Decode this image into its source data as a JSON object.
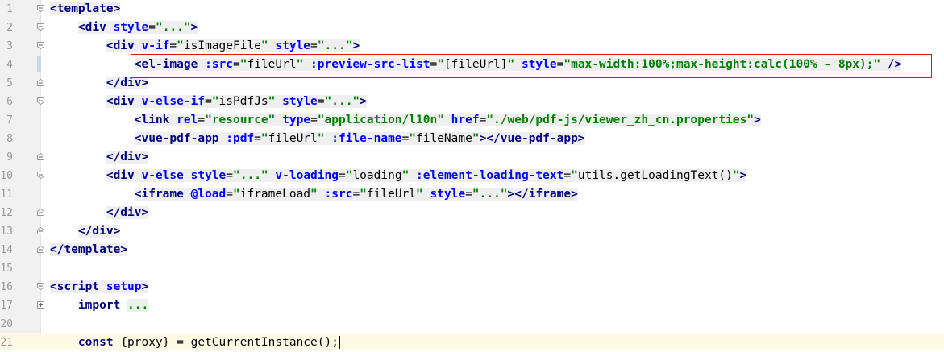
{
  "editor": {
    "line_numbers": [
      "1",
      "2",
      "3",
      "4",
      "5",
      "6",
      "7",
      "8",
      "9",
      "10",
      "11",
      "12",
      "13",
      "14",
      "15",
      "16",
      "17",
      "20",
      "21"
    ],
    "lines": [
      {
        "n": "1",
        "tokens": [
          [
            "tag",
            "<template>"
          ]
        ]
      },
      {
        "n": "2",
        "indent": "    ",
        "tokens": [
          [
            "tag",
            "<div "
          ],
          [
            "attr",
            "style"
          ],
          [
            "txt",
            "="
          ],
          [
            "str",
            "\"...\""
          ],
          [
            "tag",
            ">"
          ]
        ]
      },
      {
        "n": "3",
        "indent": "        ",
        "tokens": [
          [
            "tag",
            "<div "
          ],
          [
            "attr",
            "v-if"
          ],
          [
            "txt",
            "="
          ],
          [
            "str",
            "\""
          ],
          [
            "txt",
            "isImageFile"
          ],
          [
            "str",
            "\""
          ],
          [
            "tag",
            " "
          ],
          [
            "attr",
            "style"
          ],
          [
            "txt",
            "="
          ],
          [
            "str",
            "\"...\""
          ],
          [
            "tag",
            ">"
          ]
        ]
      },
      {
        "n": "4",
        "indent": "            ",
        "tokens": [
          [
            "tag",
            "<el-image "
          ],
          [
            "attr",
            ":src"
          ],
          [
            "txt",
            "="
          ],
          [
            "str",
            "\""
          ],
          [
            "txt",
            "fileUrl"
          ],
          [
            "str",
            "\""
          ],
          [
            "tag",
            " "
          ],
          [
            "attr",
            ":preview-src-list"
          ],
          [
            "txt",
            "="
          ],
          [
            "str",
            "\""
          ],
          [
            "txt",
            "[fileUrl]"
          ],
          [
            "str",
            "\""
          ],
          [
            "tag",
            " "
          ],
          [
            "attr",
            "style"
          ],
          [
            "txt",
            "="
          ],
          [
            "str",
            "\"max-width:100%;max-height:calc(100% - 8px);\""
          ],
          [
            "tag",
            " />"
          ]
        ]
      },
      {
        "n": "5",
        "indent": "        ",
        "tokens": [
          [
            "tag",
            "</div>"
          ]
        ]
      },
      {
        "n": "6",
        "indent": "        ",
        "tokens": [
          [
            "tag",
            "<div "
          ],
          [
            "attr",
            "v-else-if"
          ],
          [
            "txt",
            "="
          ],
          [
            "str",
            "\""
          ],
          [
            "txt",
            "isPdfJs"
          ],
          [
            "str",
            "\""
          ],
          [
            "tag",
            " "
          ],
          [
            "attr",
            "style"
          ],
          [
            "txt",
            "="
          ],
          [
            "str",
            "\"...\""
          ],
          [
            "tag",
            ">"
          ]
        ]
      },
      {
        "n": "7",
        "indent": "            ",
        "tokens": [
          [
            "tag",
            "<link "
          ],
          [
            "attr",
            "rel"
          ],
          [
            "txt",
            "="
          ],
          [
            "str",
            "\"resource\""
          ],
          [
            "tag",
            " "
          ],
          [
            "attr",
            "type"
          ],
          [
            "txt",
            "="
          ],
          [
            "str",
            "\"application/l10n\""
          ],
          [
            "tag",
            " "
          ],
          [
            "attr",
            "href"
          ],
          [
            "txt",
            "="
          ],
          [
            "str",
            "\"./web/pdf-js/viewer_zh_cn.properties\""
          ],
          [
            "tag",
            ">"
          ]
        ]
      },
      {
        "n": "8",
        "indent": "            ",
        "tokens": [
          [
            "tag",
            "<vue-pdf-app "
          ],
          [
            "attr",
            ":pdf"
          ],
          [
            "txt",
            "="
          ],
          [
            "str",
            "\""
          ],
          [
            "txt",
            "fileUrl"
          ],
          [
            "str",
            "\""
          ],
          [
            "tag",
            " "
          ],
          [
            "attr",
            ":file-name"
          ],
          [
            "txt",
            "="
          ],
          [
            "str",
            "\""
          ],
          [
            "txt",
            "fileName"
          ],
          [
            "str",
            "\""
          ],
          [
            "tag",
            "></vue-pdf-app>"
          ]
        ]
      },
      {
        "n": "9",
        "indent": "        ",
        "tokens": [
          [
            "tag",
            "</div>"
          ]
        ]
      },
      {
        "n": "10",
        "indent": "        ",
        "tokens": [
          [
            "tag",
            "<div "
          ],
          [
            "attr",
            "v-else"
          ],
          [
            "tag",
            " "
          ],
          [
            "attr",
            "style"
          ],
          [
            "txt",
            "="
          ],
          [
            "str",
            "\"...\""
          ],
          [
            "tag",
            " "
          ],
          [
            "attr",
            "v-loading"
          ],
          [
            "txt",
            "="
          ],
          [
            "str",
            "\""
          ],
          [
            "txt",
            "loading"
          ],
          [
            "str",
            "\""
          ],
          [
            "tag",
            " "
          ],
          [
            "attr",
            ":element-loading-text"
          ],
          [
            "txt",
            "="
          ],
          [
            "str",
            "\""
          ],
          [
            "txt",
            "utils.getLoadingText()"
          ],
          [
            "str",
            "\""
          ],
          [
            "tag",
            ">"
          ]
        ]
      },
      {
        "n": "11",
        "indent": "            ",
        "tokens": [
          [
            "tag",
            "<iframe "
          ],
          [
            "attr",
            "@load"
          ],
          [
            "txt",
            "="
          ],
          [
            "str",
            "\""
          ],
          [
            "txt",
            "iframeLoad"
          ],
          [
            "str",
            "\""
          ],
          [
            "tag",
            " "
          ],
          [
            "attr",
            ":src"
          ],
          [
            "txt",
            "="
          ],
          [
            "str",
            "\""
          ],
          [
            "txt",
            "fileUrl"
          ],
          [
            "str",
            "\""
          ],
          [
            "tag",
            " "
          ],
          [
            "attr",
            "style"
          ],
          [
            "txt",
            "="
          ],
          [
            "str",
            "\"...\""
          ],
          [
            "tag",
            "></iframe>"
          ]
        ]
      },
      {
        "n": "12",
        "indent": "        ",
        "tokens": [
          [
            "tag",
            "</div>"
          ]
        ]
      },
      {
        "n": "13",
        "indent": "    ",
        "tokens": [
          [
            "tag",
            "</div>"
          ]
        ]
      },
      {
        "n": "14",
        "tokens": [
          [
            "tag",
            "</template>"
          ]
        ]
      },
      {
        "n": "15",
        "tokens": []
      },
      {
        "n": "16",
        "tokens": [
          [
            "tag",
            "<script "
          ],
          [
            "attr",
            "setup"
          ],
          [
            "tag",
            ">"
          ]
        ]
      },
      {
        "n": "17",
        "indent": "    ",
        "tokens": [
          [
            "kw",
            "import "
          ],
          [
            "fold",
            "..."
          ]
        ]
      },
      {
        "n": "20",
        "tokens": []
      },
      {
        "n": "21",
        "indent": "    ",
        "tokens": [
          [
            "kw",
            "const "
          ],
          [
            "txt",
            "{proxy} = getCurrentInstance();"
          ]
        ]
      }
    ]
  },
  "highlight": {
    "color": "#e01010",
    "line": "4"
  },
  "colors": {
    "tag": "#000080",
    "attr": "#0000ff",
    "string": "#008000",
    "gutter": "#f1f1f1",
    "caret_line": "#fffae3"
  }
}
